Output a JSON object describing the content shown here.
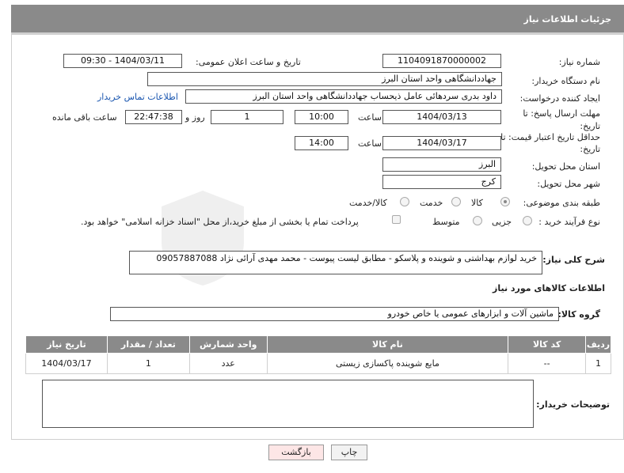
{
  "header": {
    "title": "جزئیات اطلاعات نیاز"
  },
  "form": {
    "need_number_label": "شماره نیاز:",
    "need_number": "1104091870000002",
    "announce_label": "تاریخ و ساعت اعلان عمومی:",
    "announce_value": "1404/03/11 - 09:30",
    "buyer_org_label": "نام دستگاه خریدار:",
    "buyer_org": "جهاددانشگاهی واحد استان البرز",
    "creator_label": "ایجاد کننده درخواست:",
    "creator": "داود بدری سردهائی عامل ذیحساب جهاددانشگاهی واحد استان البرز",
    "contact_link": "اطلاعات تماس خریدار",
    "deadline_label": "مهلت ارسال پاسخ: تا تاریخ:",
    "deadline_date": "1404/03/13",
    "time_label": "ساعت",
    "deadline_time": "10:00",
    "days_value": "1",
    "days_label": "روز و",
    "remaining_value": "22:47:38",
    "remaining_label": "ساعت باقی مانده",
    "price_valid_label": "حداقل تاریخ اعتبار قیمت: تا تاریخ:",
    "price_valid_date": "1404/03/17",
    "price_valid_time": "14:00",
    "province_label": "استان محل تحویل:",
    "province": "البرز",
    "city_label": "شهر محل تحویل:",
    "city": "کرج",
    "category_label": "طبقه بندی موضوعی:",
    "cat_goods": "کالا",
    "cat_service": "خدمت",
    "cat_both": "کالا/خدمت",
    "process_label": "نوع فرآیند خرید :",
    "proc_partial": "جزیی",
    "proc_medium": "متوسط",
    "payment_note": "پرداخت تمام یا بخشی از مبلغ خرید،از محل \"اسناد خزانه اسلامی\" خواهد بود.",
    "description_label": "شرح کلی نیاز:",
    "description": "خرید لوازم بهداشتی و شوینده و پلاسکو - مطابق لیست پیوست - محمد مهدی آرائی نژاد 09057887088"
  },
  "goods": {
    "section_title": "اطلاعات کالاهای مورد نیاز",
    "group_label": "گروه کالا:",
    "group_value": "ماشین آلات و ابزارهای عمومی یا خاص خودرو",
    "columns": [
      "ردیف",
      "کد کالا",
      "نام کالا",
      "واحد شمارش",
      "تعداد / مقدار",
      "تاریخ نیاز"
    ],
    "rows": [
      {
        "row": "1",
        "code": "--",
        "name": "مایع شوینده پاکسازی زیستی",
        "unit": "عدد",
        "qty": "1",
        "date": "1404/03/17"
      }
    ]
  },
  "buyer_notes_label": "توضیحات خریدار:",
  "buttons": {
    "print": "چاپ",
    "back": "بازگشت"
  },
  "colors": {
    "header_bg": "#8a8a8a",
    "link": "#1a56b0",
    "back_button": "#fde6e6"
  }
}
